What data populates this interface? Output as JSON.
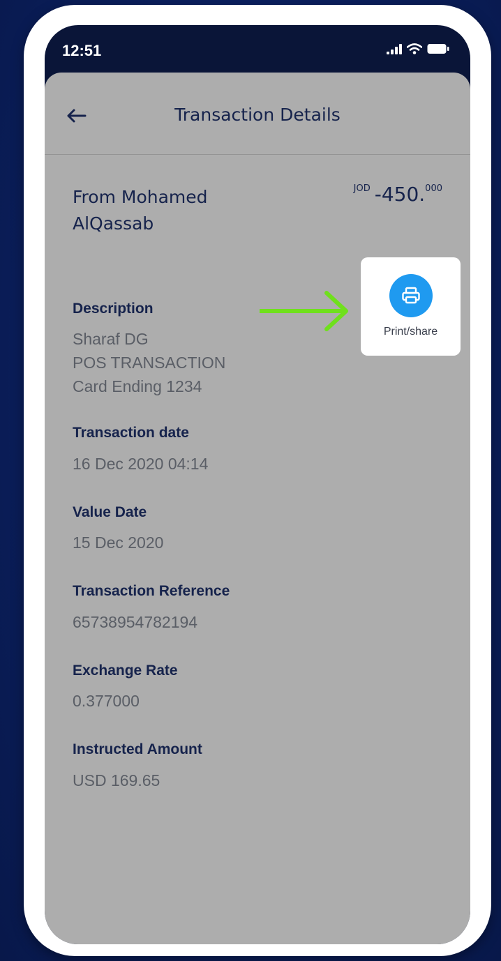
{
  "status_bar": {
    "time": "12:51",
    "signal_icon": "signal-bars-icon",
    "wifi_icon": "wifi-icon",
    "battery_icon": "battery-icon"
  },
  "nav": {
    "back_icon": "back-arrow-icon",
    "title": "Transaction Details"
  },
  "transaction": {
    "from_name": "From Mohamed AlQassab",
    "amount": {
      "currency": "JOD",
      "integer": "-450.",
      "decimal": "000"
    }
  },
  "details": [
    {
      "label": "Description",
      "value": "Sharaf DG\nPOS TRANSACTION\nCard Ending 1234"
    },
    {
      "label": "Transaction date",
      "value": "16 Dec 2020 04:14"
    },
    {
      "label": "Value Date",
      "value": "15 Dec 2020"
    },
    {
      "label": "Transaction Reference",
      "value": "65738954782194"
    },
    {
      "label": "Exchange Rate",
      "value": "0.377000"
    },
    {
      "label": "Instructed Amount",
      "value": "USD 169.65"
    }
  ],
  "print_share": {
    "label": "Print/share",
    "icon": "printer-icon"
  },
  "colors": {
    "background": "#0b2060",
    "phone_frame": "#ffffff",
    "sheet": "#adadad",
    "text_dark": "#16234c",
    "text_value": "#5a5e66",
    "accent_blue": "#1f9af0",
    "annotation_green": "#6fe01c"
  }
}
